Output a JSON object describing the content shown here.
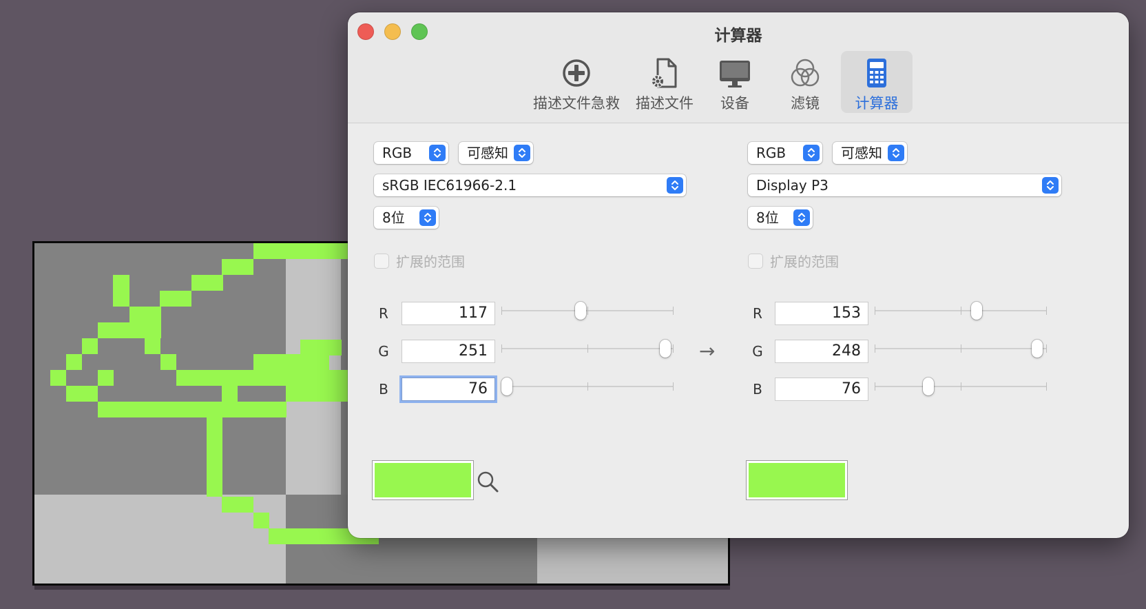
{
  "window": {
    "title": "计算器"
  },
  "colors": {
    "background": "#5f5562",
    "accent": "#2f7cf6",
    "pixel_green": "#98f74f",
    "close": "#ee5c56",
    "minimize": "#f4bd4f",
    "zoom": "#5fc454"
  },
  "tabs": [
    {
      "label": "描述文件急救",
      "icon": "first-aid-plus-icon",
      "selected": false
    },
    {
      "label": "描述文件",
      "icon": "profile-document-gear-icon",
      "selected": false
    },
    {
      "label": "设备",
      "icon": "display-monitor-icon",
      "selected": false
    },
    {
      "label": "滤镜",
      "icon": "filter-circles-icon",
      "selected": false
    },
    {
      "label": "计算器",
      "icon": "calculator-icon",
      "selected": true
    }
  ],
  "source": {
    "color_model": "RGB",
    "intent": "可感知",
    "profile": "sRGB IEC61966-2.1",
    "bit_depth": "8位",
    "extended_range_label": "扩展的范围",
    "extended_range_checked": false,
    "channels": [
      {
        "name": "R",
        "value": "117",
        "level": 0.459
      },
      {
        "name": "G",
        "value": "251",
        "level": 0.984
      },
      {
        "name": "B",
        "value": "76",
        "level": 0.0
      }
    ],
    "swatch_color": "#98f74f"
  },
  "destination": {
    "color_model": "RGB",
    "intent": "可感知",
    "profile": "Display P3",
    "bit_depth": "8位",
    "extended_range_label": "扩展的范围",
    "extended_range_checked": false,
    "channels": [
      {
        "name": "R",
        "value": "153",
        "level": 0.6
      },
      {
        "name": "G",
        "value": "248",
        "level": 0.973
      },
      {
        "name": "B",
        "value": "76",
        "level": 0.3
      }
    ],
    "swatch_color": "#98f74f"
  },
  "arrow_glyph": "→"
}
